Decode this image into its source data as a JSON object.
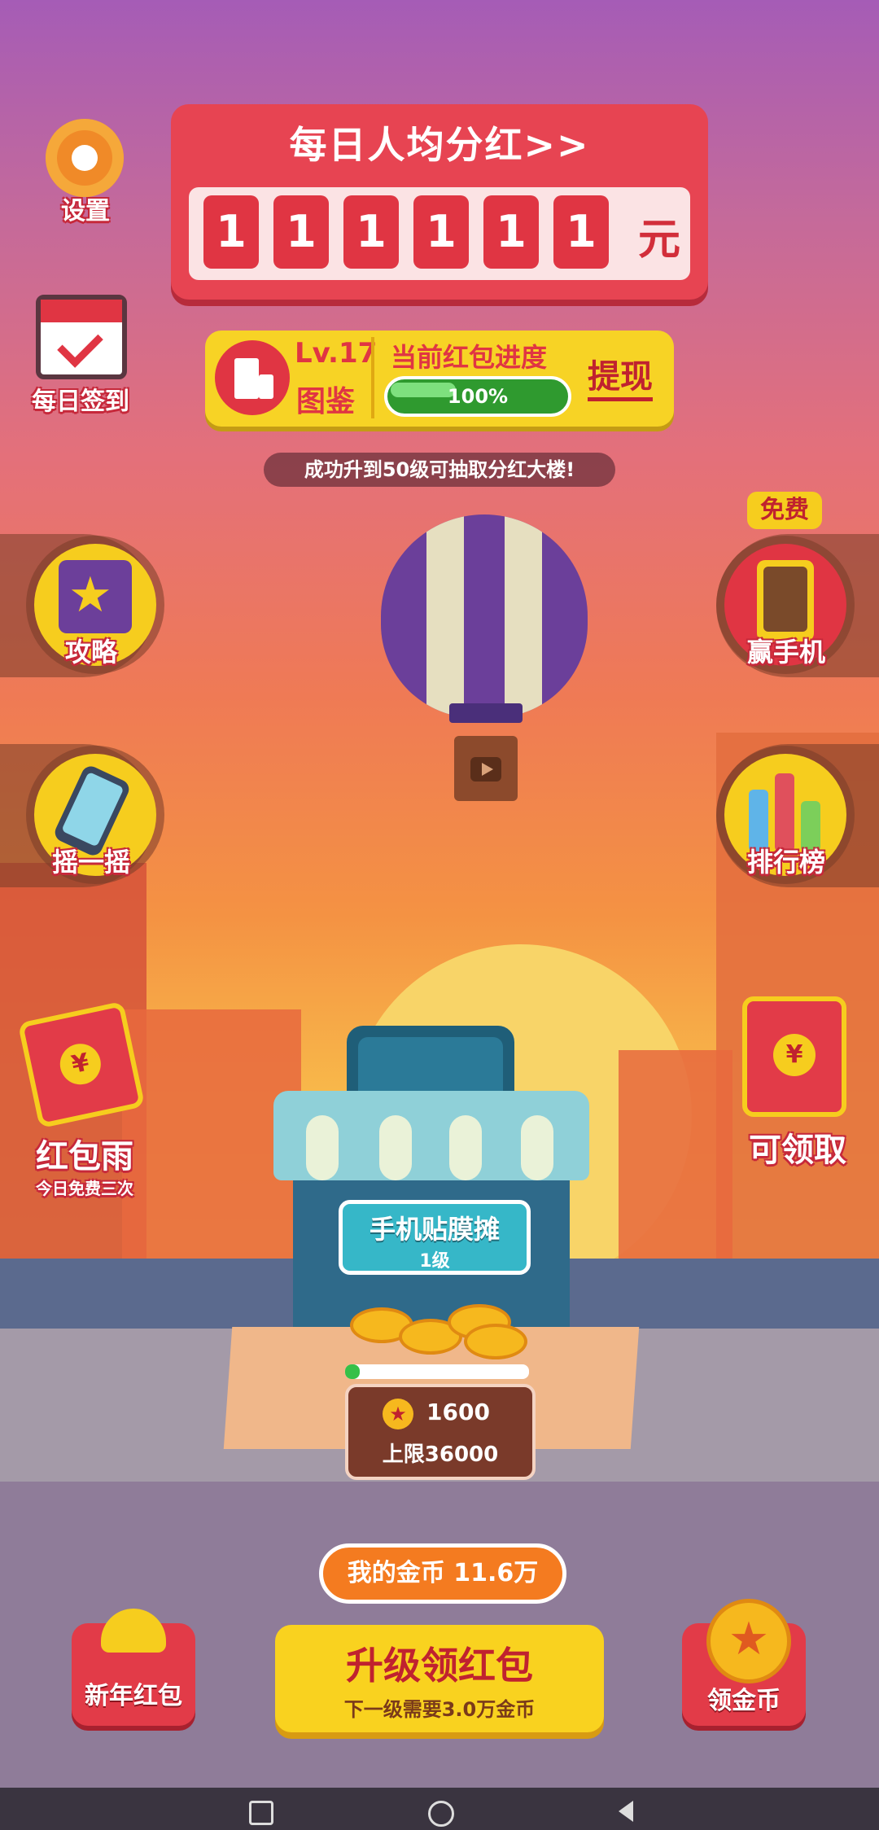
{
  "banner": {
    "title": "每日人均分红>>",
    "digits": [
      "1",
      "1",
      "1",
      "1",
      "1",
      "1"
    ],
    "unit": "元"
  },
  "settings": {
    "label": "设置"
  },
  "checkin": {
    "label": "每日签到"
  },
  "level": {
    "level_text": "Lv.17",
    "catalog_label": "图鉴",
    "progress_title": "当前红包进度",
    "progress_value": "100%",
    "withdraw_label": "提现"
  },
  "notice": "成功升到50级可抽取分红大楼!",
  "left_buttons": [
    {
      "label": "攻略"
    },
    {
      "label": "摇一摇"
    }
  ],
  "right_buttons": [
    {
      "label": "赢手机",
      "badge": "免费"
    },
    {
      "label": "排行榜"
    }
  ],
  "red_rain": {
    "label": "红包雨",
    "sub": "今日免费三次"
  },
  "claimable": {
    "label": "可领取"
  },
  "stall": {
    "name": "手机贴膜摊",
    "level": "1级",
    "coins": "1600",
    "limit": "上限36000"
  },
  "my_coins": "我的金币 11.6万",
  "upgrade": {
    "title": "升级领红包",
    "sub": "下一级需要3.0万金币"
  },
  "bottom_left": {
    "label": "新年红包"
  },
  "bottom_right": {
    "label": "领金币"
  },
  "colors": {
    "red": "#e74452",
    "yellow": "#f9d21f",
    "orange": "#f47b20"
  }
}
